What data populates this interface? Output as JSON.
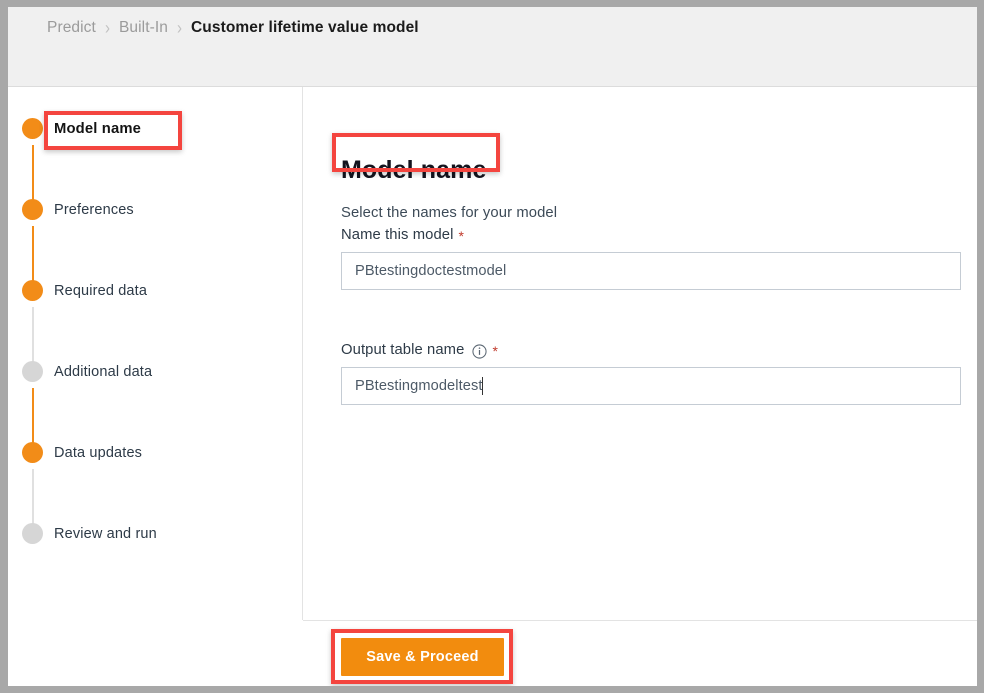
{
  "breadcrumb": {
    "items": [
      {
        "label": "Predict",
        "current": false
      },
      {
        "label": "Built-In",
        "current": false
      },
      {
        "label": "Customer lifetime value model",
        "current": true
      }
    ],
    "separator": "›"
  },
  "stepper": {
    "steps": [
      {
        "label": "Model name",
        "state": "done",
        "current": true
      },
      {
        "label": "Preferences",
        "state": "done",
        "current": false
      },
      {
        "label": "Required data",
        "state": "done",
        "current": false
      },
      {
        "label": "Additional data",
        "state": "todo",
        "current": false
      },
      {
        "label": "Data updates",
        "state": "done",
        "current": false
      },
      {
        "label": "Review and run",
        "state": "todo",
        "current": false
      }
    ]
  },
  "content": {
    "title": "Model name",
    "subtitle": "Select the names for your model",
    "fields": [
      {
        "label": "Name this model",
        "required_marker": "*",
        "value": "PBtestingdoctestmodel",
        "placeholder": "",
        "has_info_icon": false
      },
      {
        "label": "Output table name",
        "required_marker": "*",
        "value": "PBtestingmodeltest",
        "placeholder": "",
        "has_info_icon": true,
        "info_icon": "info-circle-icon"
      }
    ]
  },
  "footer": {
    "save_label": "Save & Proceed"
  },
  "colors": {
    "accent_orange": "#f28c18",
    "button_orange": "#f28c0e",
    "highlight_red": "#f4453f",
    "step_inactive": "#d6d6d6",
    "header_bg": "#f0f0f0",
    "frame_gray": "#a8a8a8",
    "required_red": "#c0392b"
  }
}
